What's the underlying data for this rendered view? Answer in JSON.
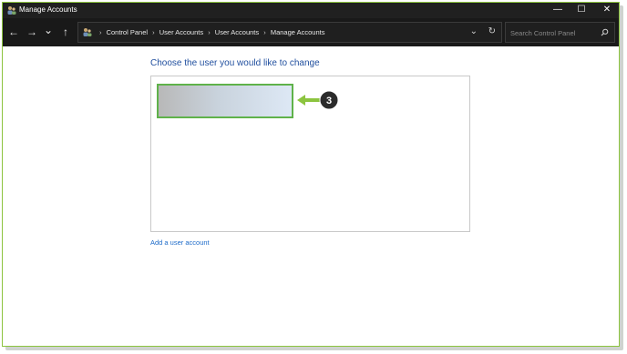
{
  "window": {
    "title": "Manage Accounts",
    "controls": {
      "minimize": "—",
      "maximize": "☐",
      "close": "✕"
    }
  },
  "nav": {
    "back_glyph": "←",
    "forward_glyph": "→",
    "recent_glyph": "⌄",
    "up_glyph": "↑",
    "breadcrumb": [
      "Control Panel",
      "User Accounts",
      "User Accounts",
      "Manage Accounts"
    ],
    "separator": "›",
    "dropdown_glyph": "⌄",
    "refresh_glyph": "↻"
  },
  "search": {
    "placeholder": "Search Control Panel",
    "icon": "search-icon"
  },
  "main": {
    "heading": "Choose the user you would like to change",
    "add_user_link": "Add a user account",
    "callout_number": "3"
  },
  "colors": {
    "accent_green": "#5fb24a",
    "heading_blue": "#1f4e9e",
    "link_blue": "#1b6ac9",
    "titlebar": "#202020"
  }
}
